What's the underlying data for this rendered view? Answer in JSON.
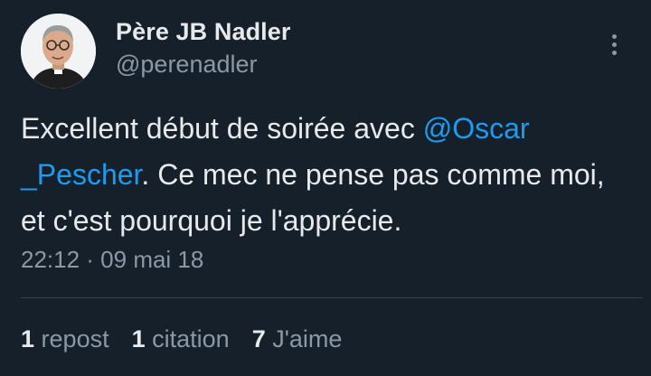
{
  "author": {
    "display_name": "Père JB Nadler",
    "handle": "@perenadler"
  },
  "tweet": {
    "text_before": "Excellent début de soirée avec ",
    "mention_line1": "@Oscar",
    "mention_line2": "_Pescher",
    "text_after": ". Ce mec ne pense pas comme moi, et c'est pourquoi je l'apprécie.",
    "timestamp": "22:12 · 09 mai 18"
  },
  "stats": {
    "reposts_count": "1",
    "reposts_label": "repost",
    "quotes_count": "1",
    "quotes_label": "citation",
    "likes_count": "7",
    "likes_label": "J'aime"
  },
  "icons": {
    "more": "more-vertical-icon",
    "avatar": "avatar"
  },
  "colors": {
    "background": "#15202b",
    "text": "#e7e9ea",
    "secondary_text": "#8b98a5",
    "mention": "#1d9bf0",
    "divider": "#38444d"
  }
}
